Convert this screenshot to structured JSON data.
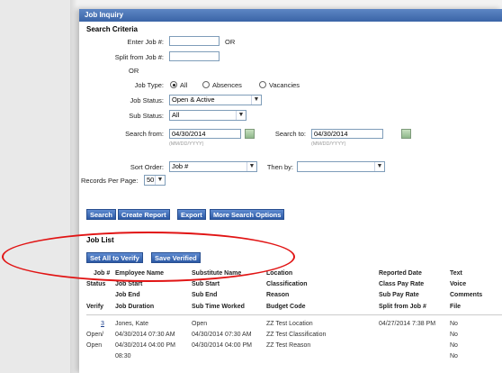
{
  "window": {
    "title": "Job Inquiry"
  },
  "search": {
    "title": "Search Criteria",
    "enter_job_label": "Enter Job #:",
    "enter_job_value": "",
    "or1": "OR",
    "split_label": "Split from Job #:",
    "split_value": "",
    "or2": "OR",
    "job_type_label": "Job Type:",
    "job_type_options": [
      "All",
      "Absences",
      "Vacancies"
    ],
    "job_type_selected": "All",
    "job_status_label": "Job Status:",
    "job_status_value": "Open & Active",
    "sub_status_label": "Sub Status:",
    "sub_status_value": "All",
    "search_from_label": "Search from:",
    "search_from_value": "04/30/2014",
    "search_from_hint": "(MM/DD/YYYY)",
    "search_to_label": "Search to:",
    "search_to_value": "04/30/2014",
    "search_to_hint": "(MM/DD/YYYY)",
    "sort_order_label": "Sort Order:",
    "sort_order_value": "Job #",
    "then_by_label": "Then by:",
    "then_by_value": "",
    "records_label": "Records Per Page:",
    "records_value": "50"
  },
  "buttons": {
    "search": "Search",
    "create_report": "Create Report",
    "export": "Export",
    "more_options": "More Search Options",
    "set_all_verify": "Set All to Verify",
    "save_verified": "Save Verified"
  },
  "job_list": {
    "title": "Job List",
    "headers": {
      "job_no": "Job #",
      "employee_name": "Employee Name",
      "substitute_name": "Substitute Name",
      "location": "Location",
      "reported_date": "Reported Date",
      "text": "Text",
      "status": "Status",
      "job_start": "Job Start",
      "sub_start": "Sub Start",
      "classification": "Classification",
      "class_pay_rate": "Class Pay Rate",
      "voice": "Voice",
      "job_end": "Job End",
      "sub_end": "Sub End",
      "reason": "Reason",
      "sub_pay_rate": "Sub Pay Rate",
      "comments": "Comments",
      "verify": "Verify",
      "job_duration": "Job Duration",
      "sub_time_worked": "Sub Time Worked",
      "budget_code": "Budget Code",
      "split_from_job": "Split from Job #",
      "file": "File"
    },
    "row": {
      "job_no": "3",
      "employee_name": "Jones, Kate",
      "substitute": "Open",
      "location": "ZZ Test Location",
      "reported_date": "04/27/2014 7:38 PM",
      "text": "No",
      "status": "Open/",
      "job_start": "04/30/2014 07:30 AM",
      "sub_start": "04/30/2014 07:30 AM",
      "classification": "ZZ Test Classification",
      "voice": "No",
      "verify": "Open",
      "job_end": "04/30/2014 04:00 PM",
      "sub_end": "04/30/2014 04:00 PM",
      "reason": "ZZ Test Reason",
      "comments": "No",
      "job_duration": "08:30",
      "file": "No"
    }
  },
  "annotation": {
    "color": "#e11414"
  }
}
